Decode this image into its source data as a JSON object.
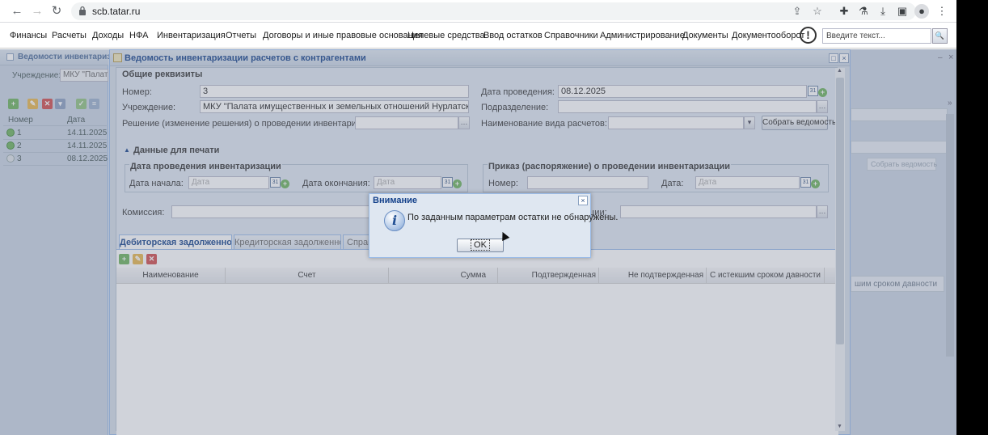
{
  "browser": {
    "url": "scb.tatar.ru"
  },
  "menu": {
    "items": [
      "Финансы",
      "Расчеты",
      "Доходы",
      "НФА",
      "Инвентаризация",
      "Отчеты",
      "Договоры и иные правовые основания",
      "Целевые средства",
      "Ввод остатков",
      "Справочники",
      "Администрирование",
      "Документы",
      "Документооборот"
    ],
    "search_placeholder": "Введите текст..."
  },
  "background": {
    "left_title": "Ведомости инвентаризац",
    "left_institution_label": "Учреждение:",
    "left_institution_value": "МКУ \"Палата",
    "grid_headers": [
      "Номер",
      "Дата"
    ],
    "rows": [
      {
        "num": "1",
        "date": "14.11.2025"
      },
      {
        "num": "2",
        "date": "14.11.2025"
      },
      {
        "num": "3",
        "date": "08.12.2025"
      }
    ],
    "right_fragment": "шим сроком давности",
    "right_button": "Собрать ведомость"
  },
  "window": {
    "title": "Ведомость инвентаризации расчетов с контрагентами",
    "general": {
      "legend": "Общие реквизиты",
      "number_label": "Номер:",
      "number_value": "3",
      "institution_label": "Учреждение:",
      "institution_value": "МКУ \"Палата имущественных и земельных отношений Нурлатского муницип",
      "decision_label": "Решение (изменение решения) о проведении инвентаризации:",
      "date_label": "Дата проведения:",
      "date_value": "08.12.2025",
      "division_label": "Подразделение:",
      "settlement_type_label": "Наименование вида расчетов:",
      "collect_button": "Собрать ведомость"
    },
    "print": {
      "legend": "Данные для печати",
      "inv_date_legend": "Дата проведения инвентаризации",
      "start_label": "Дата начала:",
      "end_label": "Дата окончания:",
      "date_placeholder": "Дата",
      "order_legend": "Приказ (распоряжение) о проведении инвентаризации",
      "order_number_label": "Номер:",
      "order_date_label": "Дата:",
      "commission_label": "Комиссия:",
      "right_label_fragment": "ции:"
    },
    "tabs": [
      {
        "label": "Дебиторская задолженность",
        "active": true
      },
      {
        "label": "Кредиторская задолженность",
        "active": false
      },
      {
        "label": "Справ",
        "active": false
      }
    ],
    "grid_columns": [
      "Наименование",
      "Счет",
      "Сумма",
      "Подтвержденная",
      "Не подтвержденная",
      "С истекшим сроком давности"
    ]
  },
  "dialog": {
    "title": "Внимание",
    "message": "По заданным параметрам остатки не обнаружены.",
    "ok_label": "OK"
  }
}
